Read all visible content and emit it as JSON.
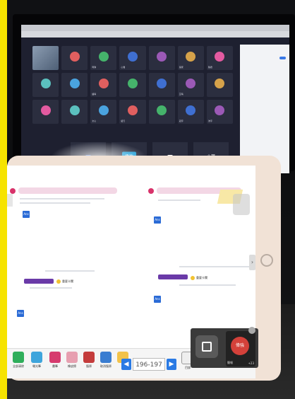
{
  "meeting": {
    "tiles": [
      {
        "label": "",
        "style": "vid"
      },
      {
        "label": ""
      },
      {
        "label": "阿琪"
      },
      {
        "label": "心雅"
      },
      {
        "label": ""
      },
      {
        "label": "張家"
      },
      {
        "label": "陳君"
      },
      {
        "label": ""
      },
      {
        "label": ""
      },
      {
        "label": "語晴"
      },
      {
        "label": ""
      },
      {
        "label": ""
      },
      {
        "label": "芷晴"
      },
      {
        "label": ""
      },
      {
        "label": ""
      },
      {
        "label": ""
      },
      {
        "label": "文心"
      },
      {
        "label": "紹元"
      },
      {
        "label": ""
      },
      {
        "label": "冠宇"
      },
      {
        "label": "沛宇"
      }
    ],
    "bottom_tiles": [
      "",
      "偉強",
      "",
      "小萍"
    ]
  },
  "ipad": {
    "pager": {
      "prev": "◀",
      "next": "▶",
      "value": "196-197"
    },
    "answer_badge": "Ans",
    "section_label": "重要卡關",
    "edge_arrow": "›"
  },
  "toolbar": {
    "items": [
      {
        "label": "全部清除",
        "color": "#2fae5b"
      },
      {
        "label": "螢光筆",
        "color": "#3fa5dc"
      },
      {
        "label": "畫筆",
        "color": "#d63b6e"
      },
      {
        "label": "橡皮擦",
        "color": "#e79fb0"
      },
      {
        "label": "復原",
        "color": "#c43c3c"
      },
      {
        "label": "取消復原",
        "color": "#3a7dd1"
      },
      {
        "label": "",
        "color": "#f2c24a"
      }
    ],
    "text_tool_label": "目錄"
  },
  "call": {
    "initials": "偉強",
    "label": "簡報",
    "count": "+23"
  }
}
